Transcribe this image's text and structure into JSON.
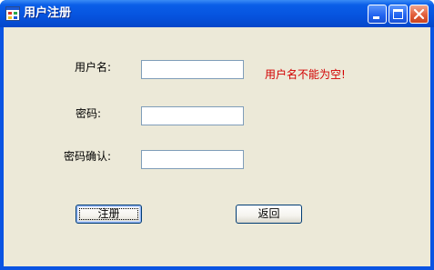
{
  "window": {
    "title": "用户注册"
  },
  "form": {
    "username_label": "用户名:",
    "username_value": "",
    "username_error": "用户名不能为空!",
    "password_label": "密码:",
    "password_value": "",
    "confirm_label": "密码确认:",
    "confirm_value": ""
  },
  "buttons": {
    "register_label": "注册",
    "back_label": "返回"
  },
  "colors": {
    "error": "#d20000",
    "title_bar": "#0653de",
    "client_bg": "#ece9d8"
  },
  "icons": [
    "app-form-icon",
    "minimize-icon",
    "maximize-icon",
    "close-icon"
  ]
}
